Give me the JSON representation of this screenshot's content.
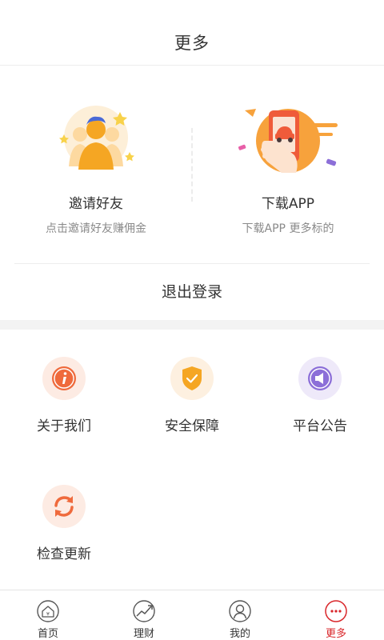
{
  "header": {
    "title": "更多"
  },
  "promo": [
    {
      "title": "邀请好友",
      "desc": "点击邀请好友赚佣金",
      "icon": "invite-friends-icon"
    },
    {
      "title": "下载APP",
      "desc": "下载APP  更多标的",
      "icon": "download-app-icon"
    }
  ],
  "logout": {
    "label": "退出登录"
  },
  "menu": [
    {
      "label": "关于我们",
      "icon": "info-icon",
      "bg": "#fdebe3",
      "color": "#ef6a3c"
    },
    {
      "label": "安全保障",
      "icon": "shield-icon",
      "bg": "#fdf0e0",
      "color": "#f5a623"
    },
    {
      "label": "平台公告",
      "icon": "announcement-icon",
      "bg": "#eee9f9",
      "color": "#8c6fd8"
    },
    {
      "label": "检查更新",
      "icon": "refresh-icon",
      "bg": "#fdebe3",
      "color": "#ef6a3c"
    }
  ],
  "tabbar": {
    "items": [
      {
        "label": "首页",
        "icon": "home-icon"
      },
      {
        "label": "理财",
        "icon": "chart-trend-icon"
      },
      {
        "label": "我的",
        "icon": "user-icon"
      },
      {
        "label": "更多",
        "icon": "more-icon"
      }
    ],
    "active": 3
  },
  "colors": {
    "accent": "#d9262a",
    "divider": "#f3f3f3"
  }
}
